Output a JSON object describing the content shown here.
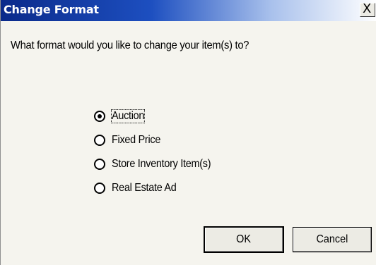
{
  "window": {
    "title": "Change Format",
    "close_glyph": "X"
  },
  "prompt": "What format would you like to change your item(s) to?",
  "options": [
    {
      "label": "Auction",
      "selected": true
    },
    {
      "label": "Fixed Price",
      "selected": false
    },
    {
      "label": "Store Inventory Item(s)",
      "selected": false
    },
    {
      "label": "Real Estate Ad",
      "selected": false
    }
  ],
  "buttons": {
    "ok_label": "OK",
    "cancel_label": "Cancel"
  },
  "colors": {
    "titlebar_start": "#0a2a8a",
    "titlebar_end": "#ffffff",
    "dialog_bg": "#f5f4ee"
  },
  "icons": {
    "close": "close-icon",
    "radio_selected": "radio-selected-icon",
    "radio_unselected": "radio-unselected-icon"
  }
}
